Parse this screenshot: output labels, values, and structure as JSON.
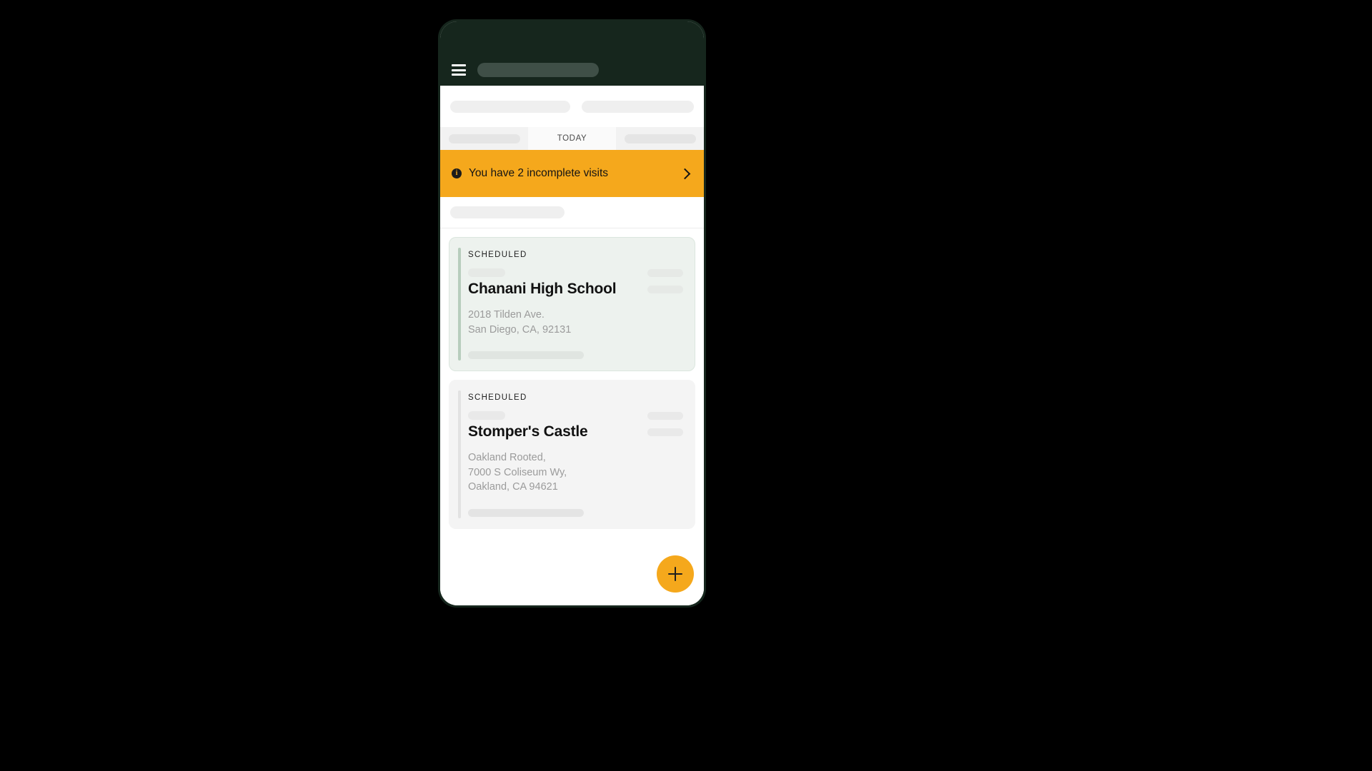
{
  "app": {
    "menu_icon": "hamburger-menu-icon",
    "title_placeholder": ""
  },
  "tabs": [
    {
      "label": "",
      "active": false,
      "placeholder": true
    },
    {
      "label": "TODAY",
      "active": true,
      "placeholder": false
    },
    {
      "label": "",
      "active": false,
      "placeholder": true
    }
  ],
  "alert": {
    "icon": "info-icon",
    "glyph": "i",
    "message": "You have 2 incomplete visits",
    "chevron": "chevron-right-icon",
    "count": 2,
    "background_color": "#f5a81c"
  },
  "cards": [
    {
      "status": "SCHEDULED",
      "title": "Chanani High School",
      "address_lines": [
        "2018 Tilden Ave.",
        "San Diego, CA, 92131"
      ],
      "accent_color": "#b7cdbd",
      "background_color": "#edf2ee",
      "theme": "green"
    },
    {
      "status": "SCHEDULED",
      "title": "Stomper's Castle",
      "address_lines": [
        "Oakland Rooted,",
        "7000 S Coliseum Wy,",
        "Oakland, CA 94621"
      ],
      "accent_color": "#e2e2e2",
      "background_color": "#f4f4f4",
      "theme": "gray"
    }
  ],
  "fab": {
    "icon": "plus-icon",
    "label": "+",
    "background_color": "#f5a81c"
  },
  "colors": {
    "app_bar": "#16261d",
    "accent_orange": "#f5a81c",
    "page_background": "#000000"
  }
}
